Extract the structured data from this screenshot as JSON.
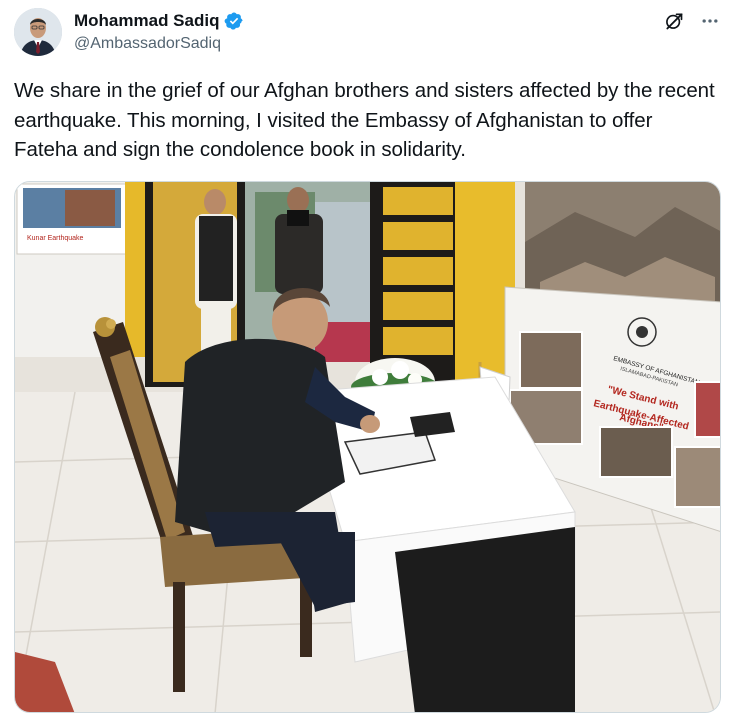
{
  "author": {
    "name": "Mohammad Sadiq",
    "handle": "@AmbassadorSadiq",
    "verified": true
  },
  "actions": {
    "grok_icon": "grok-icon",
    "more_icon": "more-icon"
  },
  "tweet": {
    "text": "We share in the grief of our Afghan brothers and sisters affected by the recent earthquake. This morning, I visited the Embassy of Afghanistan to offer Fateha and sign the condolence book in solidarity."
  },
  "media": {
    "banner_line1": "EMBASSY OF AFGHANISTAN",
    "banner_line2": "ISLAMABAD-PAKISTAN",
    "banner_slogan_1": "\"We Stand with",
    "banner_slogan_2": "Earthquake-Affected",
    "banner_slogan_3": "Afghans\"",
    "left_poster_caption": "Kunar Earthquake"
  },
  "colors": {
    "verified_blue": "#1d9bf0",
    "text_primary": "#0f1419",
    "text_secondary": "#536471",
    "slogan_red": "#b3261e"
  }
}
